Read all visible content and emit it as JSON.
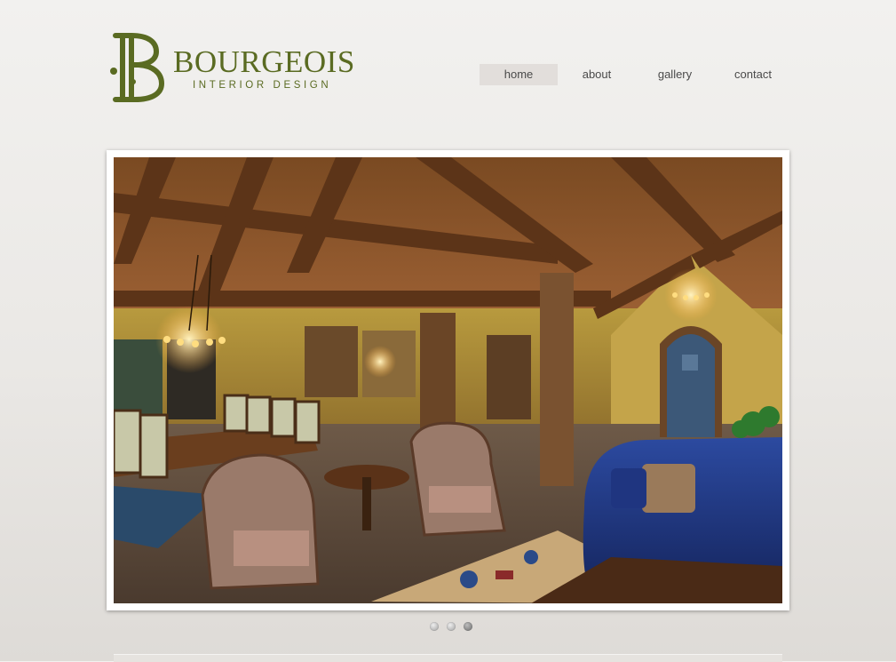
{
  "brand": {
    "monogram": "B",
    "name": "BOURGEOIS",
    "tagline": "INTERIOR DESIGN"
  },
  "nav": {
    "items": [
      {
        "label": "home",
        "active": true
      },
      {
        "label": "about",
        "active": false
      },
      {
        "label": "gallery",
        "active": false
      },
      {
        "label": "contact",
        "active": false
      }
    ]
  },
  "slider": {
    "slide_count": 3,
    "active_slide": 3
  },
  "colors": {
    "brand_green": "#5a6b22",
    "nav_active_bg": "#e2dedb",
    "page_bg": "#eceae7"
  }
}
